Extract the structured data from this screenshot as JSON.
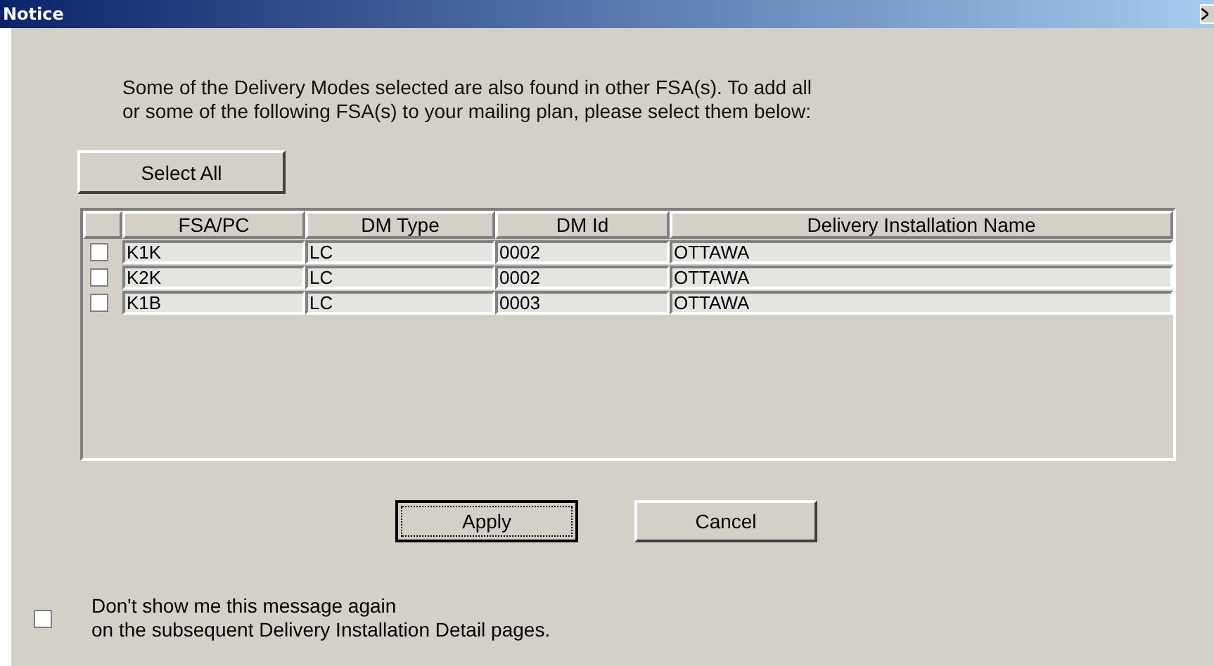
{
  "window": {
    "title": "Notice"
  },
  "message": "Some of the Delivery Modes selected are also found in other FSA(s). To add all\nor some of the following FSA(s) to your mailing plan, please select them below:",
  "select_all_button": "Select All",
  "table": {
    "columns": [
      "FSA/PC",
      "DM Type",
      "DM Id",
      "Delivery Installation Name"
    ],
    "rows": [
      {
        "checked": false,
        "cells": [
          "K1K",
          "LC",
          "0002",
          "OTTAWA"
        ]
      },
      {
        "checked": false,
        "cells": [
          "K2K",
          "LC",
          "0002",
          "OTTAWA"
        ]
      },
      {
        "checked": false,
        "cells": [
          "K1B",
          "LC",
          "0003",
          "OTTAWA"
        ]
      }
    ]
  },
  "buttons": [
    {
      "label": "Apply",
      "focused": true
    },
    {
      "label": "Cancel",
      "focused": false
    }
  ],
  "dont_show": {
    "checked": false,
    "label": "Don't show me this message again\non the subsequent Delivery Installation Detail pages."
  }
}
